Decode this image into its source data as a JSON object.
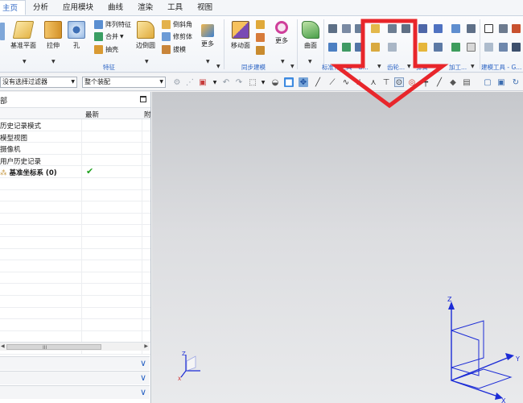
{
  "tabs": [
    "主页",
    "分析",
    "应用模块",
    "曲线",
    "渲染",
    "工具",
    "视图"
  ],
  "ribbon": {
    "datum_plane": "基准平面",
    "extrude": "拉伸",
    "hole": "孔",
    "pattern_feature": "阵列特征",
    "unite": "合并",
    "shell": "抽壳",
    "edge_blend": "边倒圆",
    "chamfer": "倒斜角",
    "trim_body": "修剪体",
    "draft": "拔模",
    "more1": "更多",
    "group_feature": "特征",
    "move_face": "移动面",
    "more2": "更多",
    "group_sync": "同步建模",
    "surface": "曲面",
    "group_standard": "标准化工具 - G...",
    "group_gear": "齿轮...",
    "group_spring": "弹簧",
    "group_machining": "加工...",
    "group_modeling_tools": "建模工具 - G..."
  },
  "toolbar": {
    "filter": "没有选择过滤器",
    "scope": "整个装配"
  },
  "navigator": {
    "title": "部",
    "col_latest": "最新",
    "col_extra": "附",
    "rows": [
      "历史记录模式",
      "模型视图",
      "摄像机",
      "用户历史记录"
    ],
    "datum_row": "基准坐标系 (0)",
    "scroll_label": "III"
  },
  "triad": {
    "x": "X",
    "y": "Y",
    "z": "Z"
  },
  "colors": {
    "accent": "#2a63c4",
    "check": "#1fa11f",
    "annotation": "#e8262b",
    "triad_blue": "#1b2bd6"
  }
}
